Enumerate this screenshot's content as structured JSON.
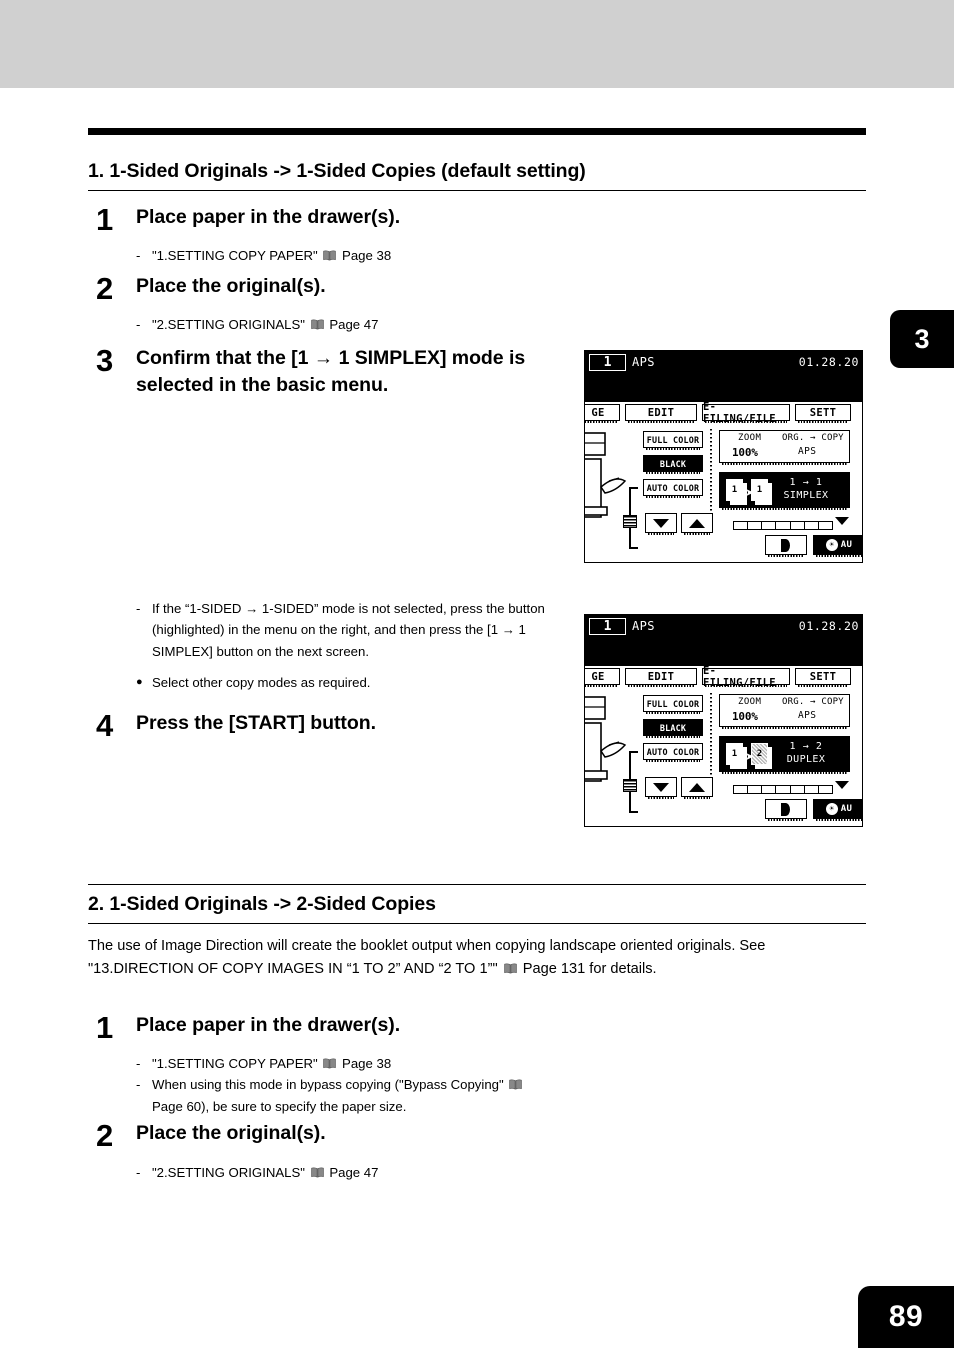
{
  "page": {
    "number": "89",
    "chapter_tab": "3"
  },
  "sections": [
    {
      "heading": "1. 1-Sided Originals -> 1-Sided Copies (default setting)",
      "steps": [
        {
          "num": "1",
          "title": "Place paper in the drawer(s).",
          "notes": [
            {
              "mark": "-",
              "text": "\"1.SETTING COPY PAPER\"",
              "icon": "book-icon",
              "ref": "Page 38"
            }
          ]
        },
        {
          "num": "2",
          "title": "Place the original(s).",
          "notes": [
            {
              "mark": "-",
              "text": "\"2.SETTING ORIGINALS\"",
              "icon": "book-icon",
              "ref": "Page 47"
            }
          ]
        },
        {
          "num": "3",
          "title_line1": "Confirm that the [1 → 1 SIMPLEX] mode is",
          "title_line2": "selected in the basic menu.",
          "notes": [
            {
              "mark": "-",
              "text": "If the “1-SIDED → 1-SIDED” mode is not selected, press the button (highlighted) in the menu on the right, and then press the [1 → 1 SIMPLEX] button on the next screen."
            },
            {
              "mark": "●",
              "text": "Select other copy modes as required."
            }
          ]
        },
        {
          "num": "4",
          "title": "Press the [START] button.",
          "notes": []
        }
      ]
    },
    {
      "heading": "2. 1-Sided Originals -> 2-Sided Copies",
      "paragraph_line1": "The use of Image Direction will create the booklet output when copying landscape oriented originals. See",
      "paragraph_line2_a": "\"13.DIRECTION OF COPY IMAGES IN “1 TO 2” AND “2 TO 1”\"",
      "paragraph_line2_b": "Page 131 for details.",
      "steps": [
        {
          "num": "1",
          "title": "Place paper in the drawer(s).",
          "notes": [
            {
              "mark": "-",
              "text": "\"1.SETTING COPY PAPER\"",
              "icon": "book-icon",
              "ref": "Page 38"
            },
            {
              "mark": "-",
              "text": "When using this mode in bypass copying (\"Bypass Copying\"",
              "icon": "book-icon",
              "ref": "Page 60), be sure to specify the paper size."
            }
          ]
        },
        {
          "num": "2",
          "title": "Place the original(s).",
          "notes": [
            {
              "mark": "-",
              "text": "\"2.SETTING ORIGINALS\"",
              "icon": "book-icon",
              "ref": "Page 47"
            }
          ]
        }
      ]
    }
  ],
  "lcd_simplex": {
    "copies": "1",
    "paper_mode": "APS",
    "date": "01.28.20",
    "tabs": [
      "GE",
      "EDIT",
      "E-FILING/FILE",
      "SETT"
    ],
    "color_buttons": [
      {
        "label": "FULL COLOR",
        "selected": false
      },
      {
        "label": "BLACK",
        "selected": true
      },
      {
        "label": "AUTO COLOR",
        "selected": false
      }
    ],
    "zoom_label": "ZOOM",
    "zoom_value": "100%",
    "orgcopy_label": "ORG. → COPY",
    "orgcopy_value": "APS",
    "mode_line1": "1 → 1",
    "mode_line2": "SIMPLEX",
    "mode_src": "1",
    "mode_dst": "1",
    "contrast_label": "◖",
    "autoexp_label": "AU"
  },
  "lcd_duplex": {
    "copies": "1",
    "paper_mode": "APS",
    "date": "01.28.20",
    "tabs": [
      "GE",
      "EDIT",
      "E-FILING/FILE",
      "SETT"
    ],
    "color_buttons": [
      {
        "label": "FULL COLOR",
        "selected": false
      },
      {
        "label": "BLACK",
        "selected": true
      },
      {
        "label": "AUTO COLOR",
        "selected": false
      }
    ],
    "zoom_label": "ZOOM",
    "zoom_value": "100%",
    "orgcopy_label": "ORG. → COPY",
    "orgcopy_value": "APS",
    "mode_line1": "1 → 2",
    "mode_line2": "DUPLEX",
    "mode_src": "1",
    "mode_dst": "2",
    "contrast_label": "◖",
    "autoexp_label": "AU"
  }
}
